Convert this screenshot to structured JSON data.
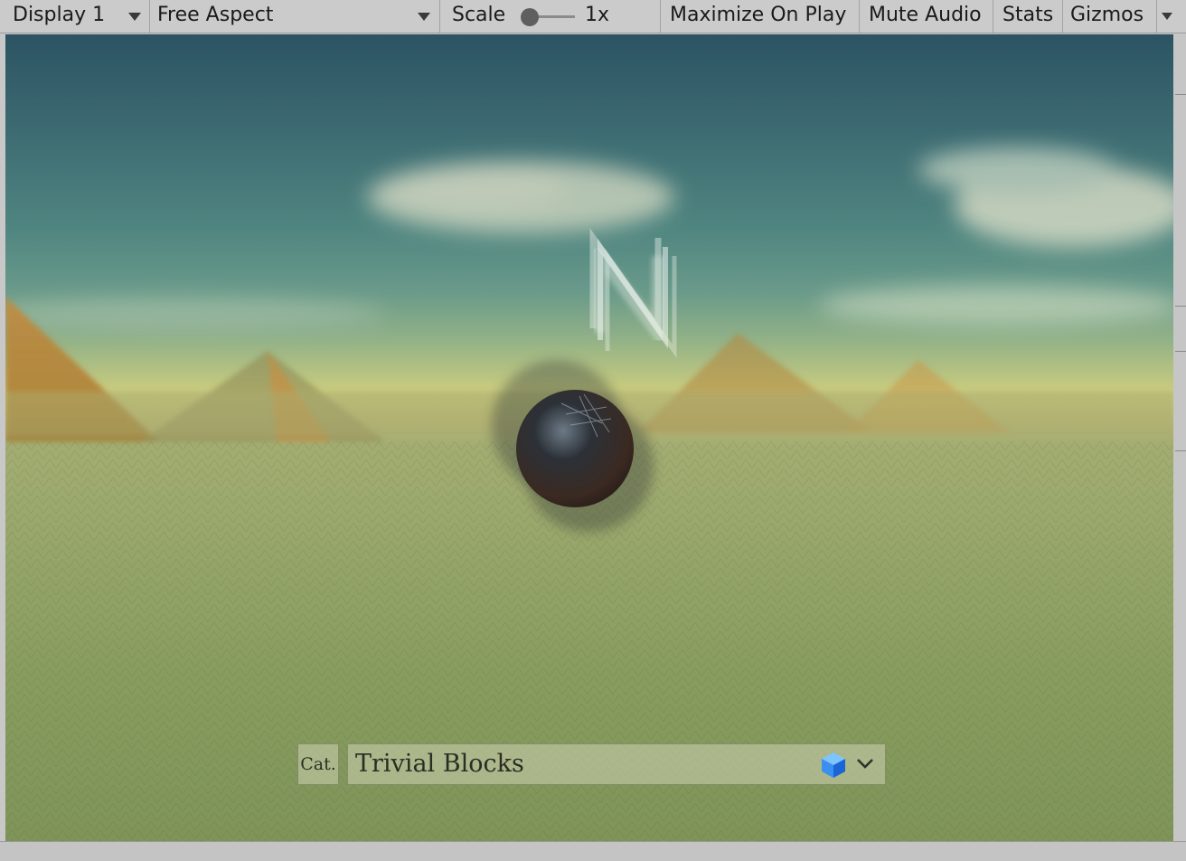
{
  "toolbar": {
    "display": "Display 1",
    "aspect": "Free Aspect",
    "scale_label": "Scale",
    "scale_value": "1x",
    "maximize": "Maximize On Play",
    "mute": "Mute Audio",
    "stats": "Stats",
    "gizmos": "Gizmos"
  },
  "hud": {
    "category_button": "Cat.",
    "selected_category": "Trivial Blocks",
    "category_icon": "blue-cube-icon"
  },
  "colors": {
    "toolbar_bg": "#cbcbcb",
    "cube_blue": "#3a8ff0"
  }
}
